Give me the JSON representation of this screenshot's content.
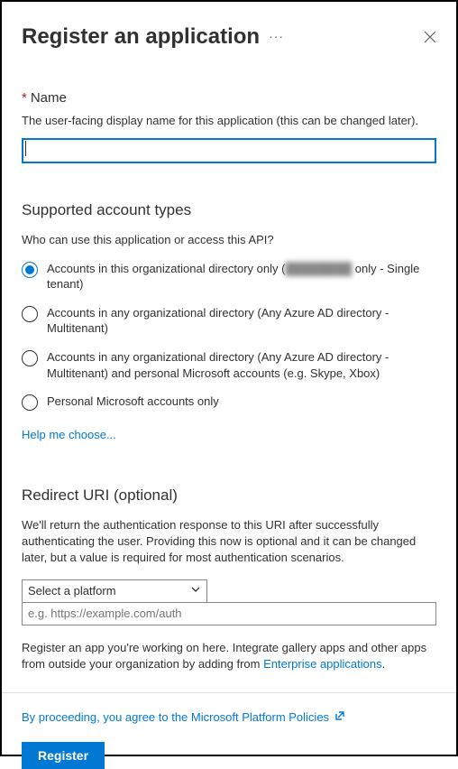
{
  "header": {
    "title": "Register an application"
  },
  "name": {
    "label": "Name",
    "helper": "The user-facing display name for this application (this can be changed later).",
    "value": ""
  },
  "accountTypes": {
    "heading": "Supported account types",
    "question": "Who can use this application or access this API?",
    "options": [
      {
        "label_pre": "Accounts in this organizational directory only (",
        "label_blur": "████████",
        "label_post": " only - Single tenant)",
        "selected": true
      },
      {
        "label": "Accounts in any organizational directory (Any Azure AD directory - Multitenant)",
        "selected": false
      },
      {
        "label": "Accounts in any organizational directory (Any Azure AD directory - Multitenant) and personal Microsoft accounts (e.g. Skype, Xbox)",
        "selected": false
      },
      {
        "label": "Personal Microsoft accounts only",
        "selected": false
      }
    ],
    "helpLink": "Help me choose..."
  },
  "redirect": {
    "heading": "Redirect URI (optional)",
    "description": "We'll return the authentication response to this URI after successfully authenticating the user. Providing this now is optional and it can be changed later, but a value is required for most authentication scenarios.",
    "platformPlaceholder": "Select a platform",
    "uriPlaceholder": "e.g. https://example.com/auth"
  },
  "footerNote": {
    "text": "Register an app you're working on here. Integrate gallery apps and other apps from outside your organization by adding from ",
    "link": "Enterprise applications",
    "suffix": "."
  },
  "policy": {
    "text": "By proceeding, you agree to the Microsoft Platform Policies"
  },
  "buttons": {
    "register": "Register"
  }
}
